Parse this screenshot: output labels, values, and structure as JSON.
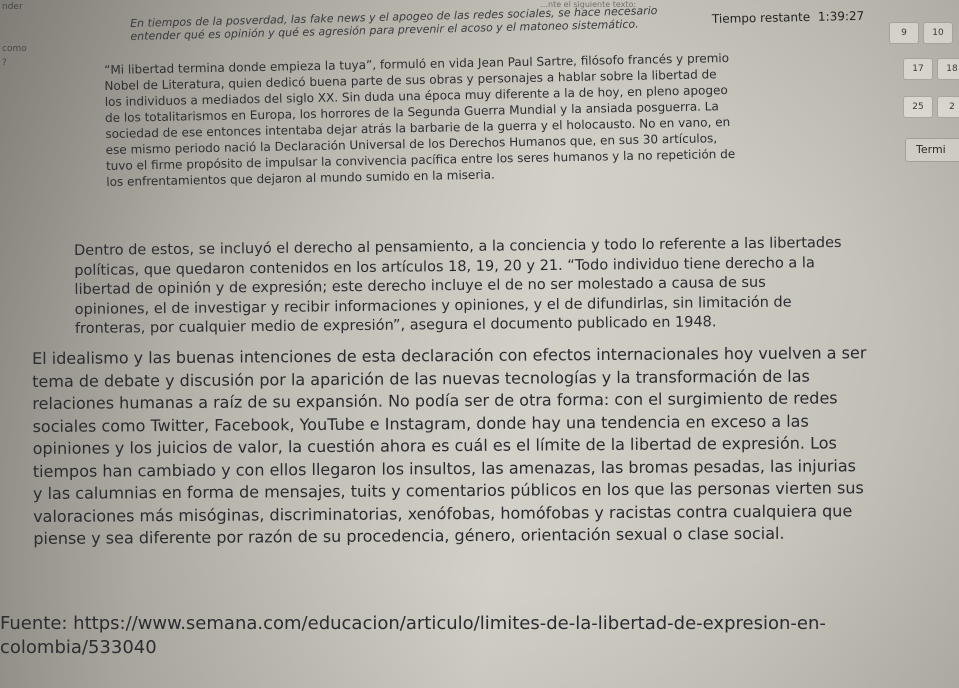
{
  "top_instruction": "…nte el siguiente texto:",
  "left_strip": [
    "nder",
    "como",
    "?"
  ],
  "timer": {
    "label": "Tiempo restante",
    "value": "1:39:27"
  },
  "question_grid": [
    {
      "number": "9"
    },
    {
      "number": "10"
    },
    {
      "number": "17"
    },
    {
      "number": "18"
    },
    {
      "number": "25"
    },
    {
      "number": "2"
    }
  ],
  "finish_button": "Termi",
  "passage": {
    "p1": [
      "En tiempos de la posverdad, las fake news y el apogeo de las redes sociales, se hace necesario",
      "entender qué es opinión y qué es agresión para prevenir el acoso y el matoneo sistemático."
    ],
    "p2": [
      "“Mi libertad termina donde empieza la tuya”, formuló en vida Jean Paul Sartre, filósofo francés y premio",
      "Nobel de Literatura, quien dedicó buena parte de sus obras y personajes a hablar sobre la libertad de",
      "los individuos a mediados del siglo XX. Sin duda una época muy diferente a la de hoy, en pleno apogeo",
      "de los totalitarismos en Europa, los horrores de la Segunda Guerra Mundial y la ansiada posguerra. La",
      "sociedad de ese entonces intentaba dejar atrás la barbarie de la guerra y el holocausto. No en vano, en",
      "ese mismo periodo nació la Declaración Universal de los Derechos Humanos que, en sus 30 artículos,",
      "tuvo el firme propósito de impulsar la convivencia pacífica entre los seres humanos y la no repetición de",
      "los enfrentamientos que dejaron al mundo sumido en la miseria."
    ],
    "p3": [
      "Dentro de estos, se incluyó el derecho al pensamiento, a la conciencia y todo lo referente a las libertades",
      "políticas, que quedaron contenidos en los artículos 18, 19, 20 y 21. “Todo individuo tiene derecho a la",
      "libertad de opinión y de expresión; este derecho incluye el de no ser molestado a causa de sus",
      "opiniones, el de investigar y recibir informaciones y opiniones, y el de difundirlas, sin limitación de",
      "fronteras, por cualquier medio de expresión”, asegura el documento publicado en 1948."
    ],
    "p4": [
      "El idealismo y las buenas intenciones de esta declaración con efectos internacionales hoy vuelven a ser",
      "tema de debate y discusión por la aparición de las nuevas tecnologías y la transformación de las",
      "relaciones humanas a raíz de su expansión. No podía ser de otra forma: con el surgimiento de redes",
      "sociales como Twitter, Facebook, YouTube e Instagram, donde hay una tendencia en exceso a las",
      "opiniones y los juicios de valor, la cuestión ahora es cuál es el límite de la libertad de expresión. Los",
      "tiempos han cambiado y con ellos llegaron los insultos, las amenazas, las bromas pesadas, las injurias",
      "y las calumnias en forma de mensajes, tuits y comentarios públicos en los que las personas vierten sus",
      "valoraciones más misóginas, discriminatorias, xenófobas, homófobas y racistas contra cualquiera que",
      "piense y sea diferente por razón de su procedencia, género, orientación sexual o clase social."
    ],
    "source": [
      "Fuente: https://www.semana.com/educacion/articulo/limites-de-la-libertad-de-expresion-en-",
      "colombia/533040"
    ]
  }
}
